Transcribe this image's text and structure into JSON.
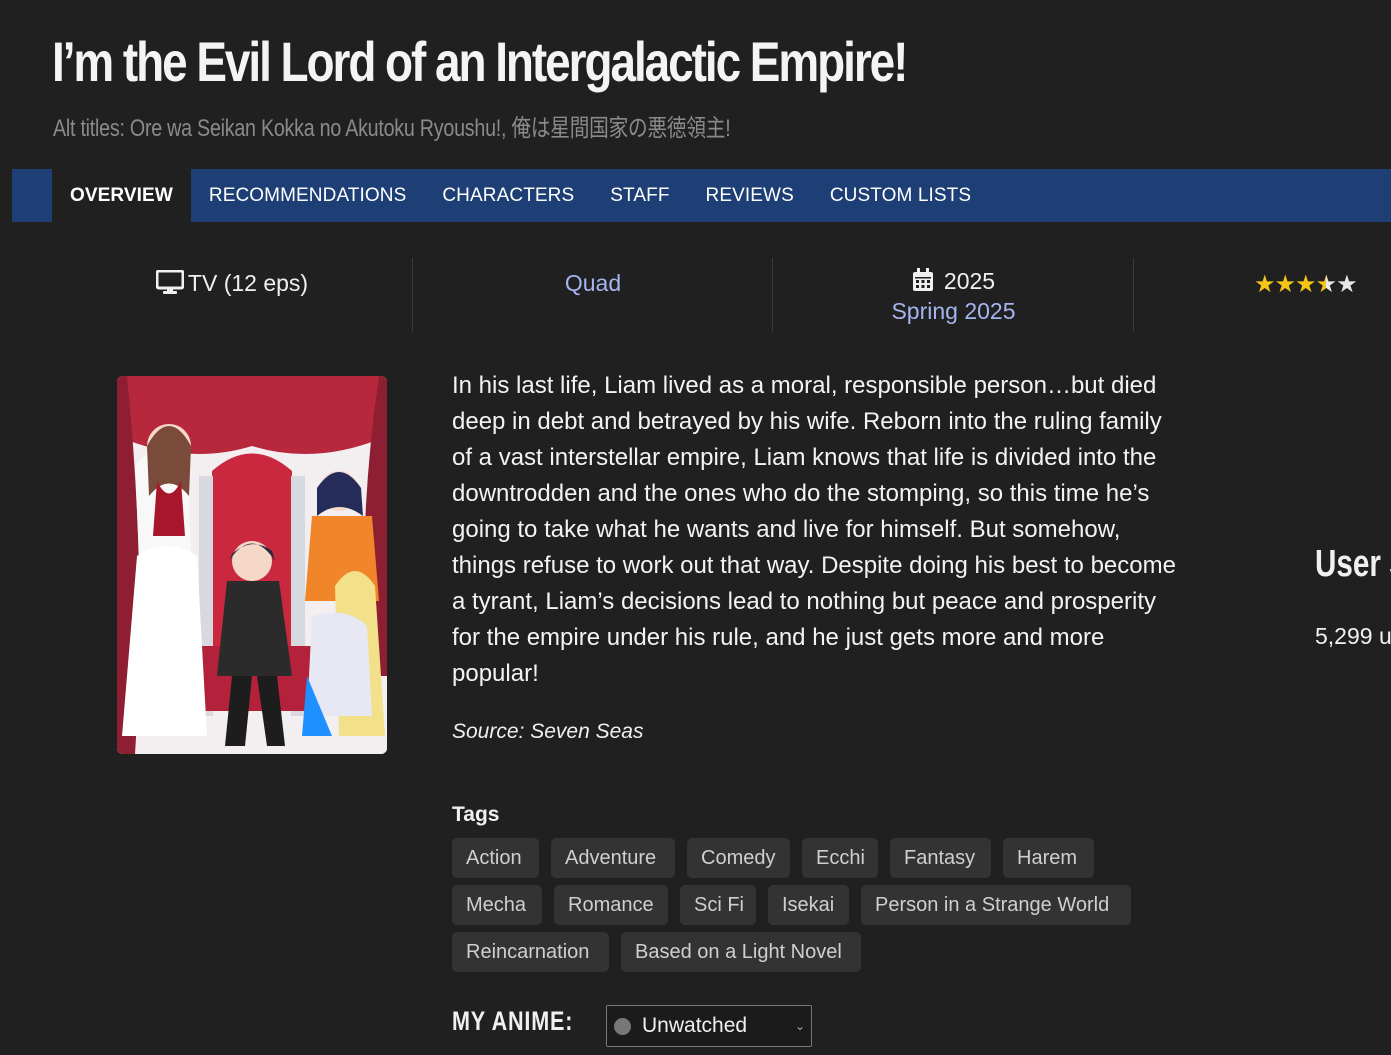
{
  "header": {
    "title": "I’m the Evil Lord of an Intergalactic Empire!",
    "alt_titles": "Alt titles: Ore wa Seikan Kokka no Akutoku Ryoushu!, 俺は星間国家の悪徳領主!"
  },
  "nav": {
    "tabs": [
      {
        "label": "OVERVIEW",
        "active": true
      },
      {
        "label": "RECOMMENDATIONS",
        "active": false
      },
      {
        "label": "CHARACTERS",
        "active": false
      },
      {
        "label": "STAFF",
        "active": false
      },
      {
        "label": "REVIEWS",
        "active": false
      },
      {
        "label": "CUSTOM LISTS",
        "active": false
      }
    ]
  },
  "stats": {
    "type": "TV (12 eps)",
    "type_icon": "monitor-icon",
    "studio": "Quad",
    "year": "2025",
    "year_icon": "calendar-icon",
    "season": "Spring 2025",
    "rating_stars": 3.5,
    "rating_max": 5,
    "star_color": "#f5c518"
  },
  "synopsis": "In his last life, Liam lived as a moral, responsible person…but died deep in debt and betrayed by his wife. Reborn into the ruling family of a vast interstellar empire, Liam knows that life is divided into the downtrodden and the ones who do the stomping, so this time he’s going to take what he wants and live for himself. But somehow, things refuse to work out that way. Despite doing his best to become a tyrant, Liam’s decisions lead to nothing but peace and prosperity for the empire under his rule, and he just gets more and more popular!",
  "source": "Source: Seven Seas",
  "tags": {
    "heading": "Tags",
    "items": [
      "Action",
      "Adventure",
      "Comedy",
      "Ecchi",
      "Fantasy",
      "Harem",
      "Mecha",
      "Romance",
      "Sci Fi",
      "Isekai",
      "Person in a Strange World",
      "Reincarnation",
      "Based on a Light Novel"
    ]
  },
  "my_anime": {
    "label": "MY ANIME:",
    "status": "Unwatched",
    "status_dot_color": "#777777"
  },
  "user_stats": {
    "heading": "User S",
    "count": "5,299 u"
  },
  "colors": {
    "background": "#202020",
    "nav_bar": "#1e3f75",
    "link": "#a6b4f0",
    "tag_bg": "#333333"
  }
}
